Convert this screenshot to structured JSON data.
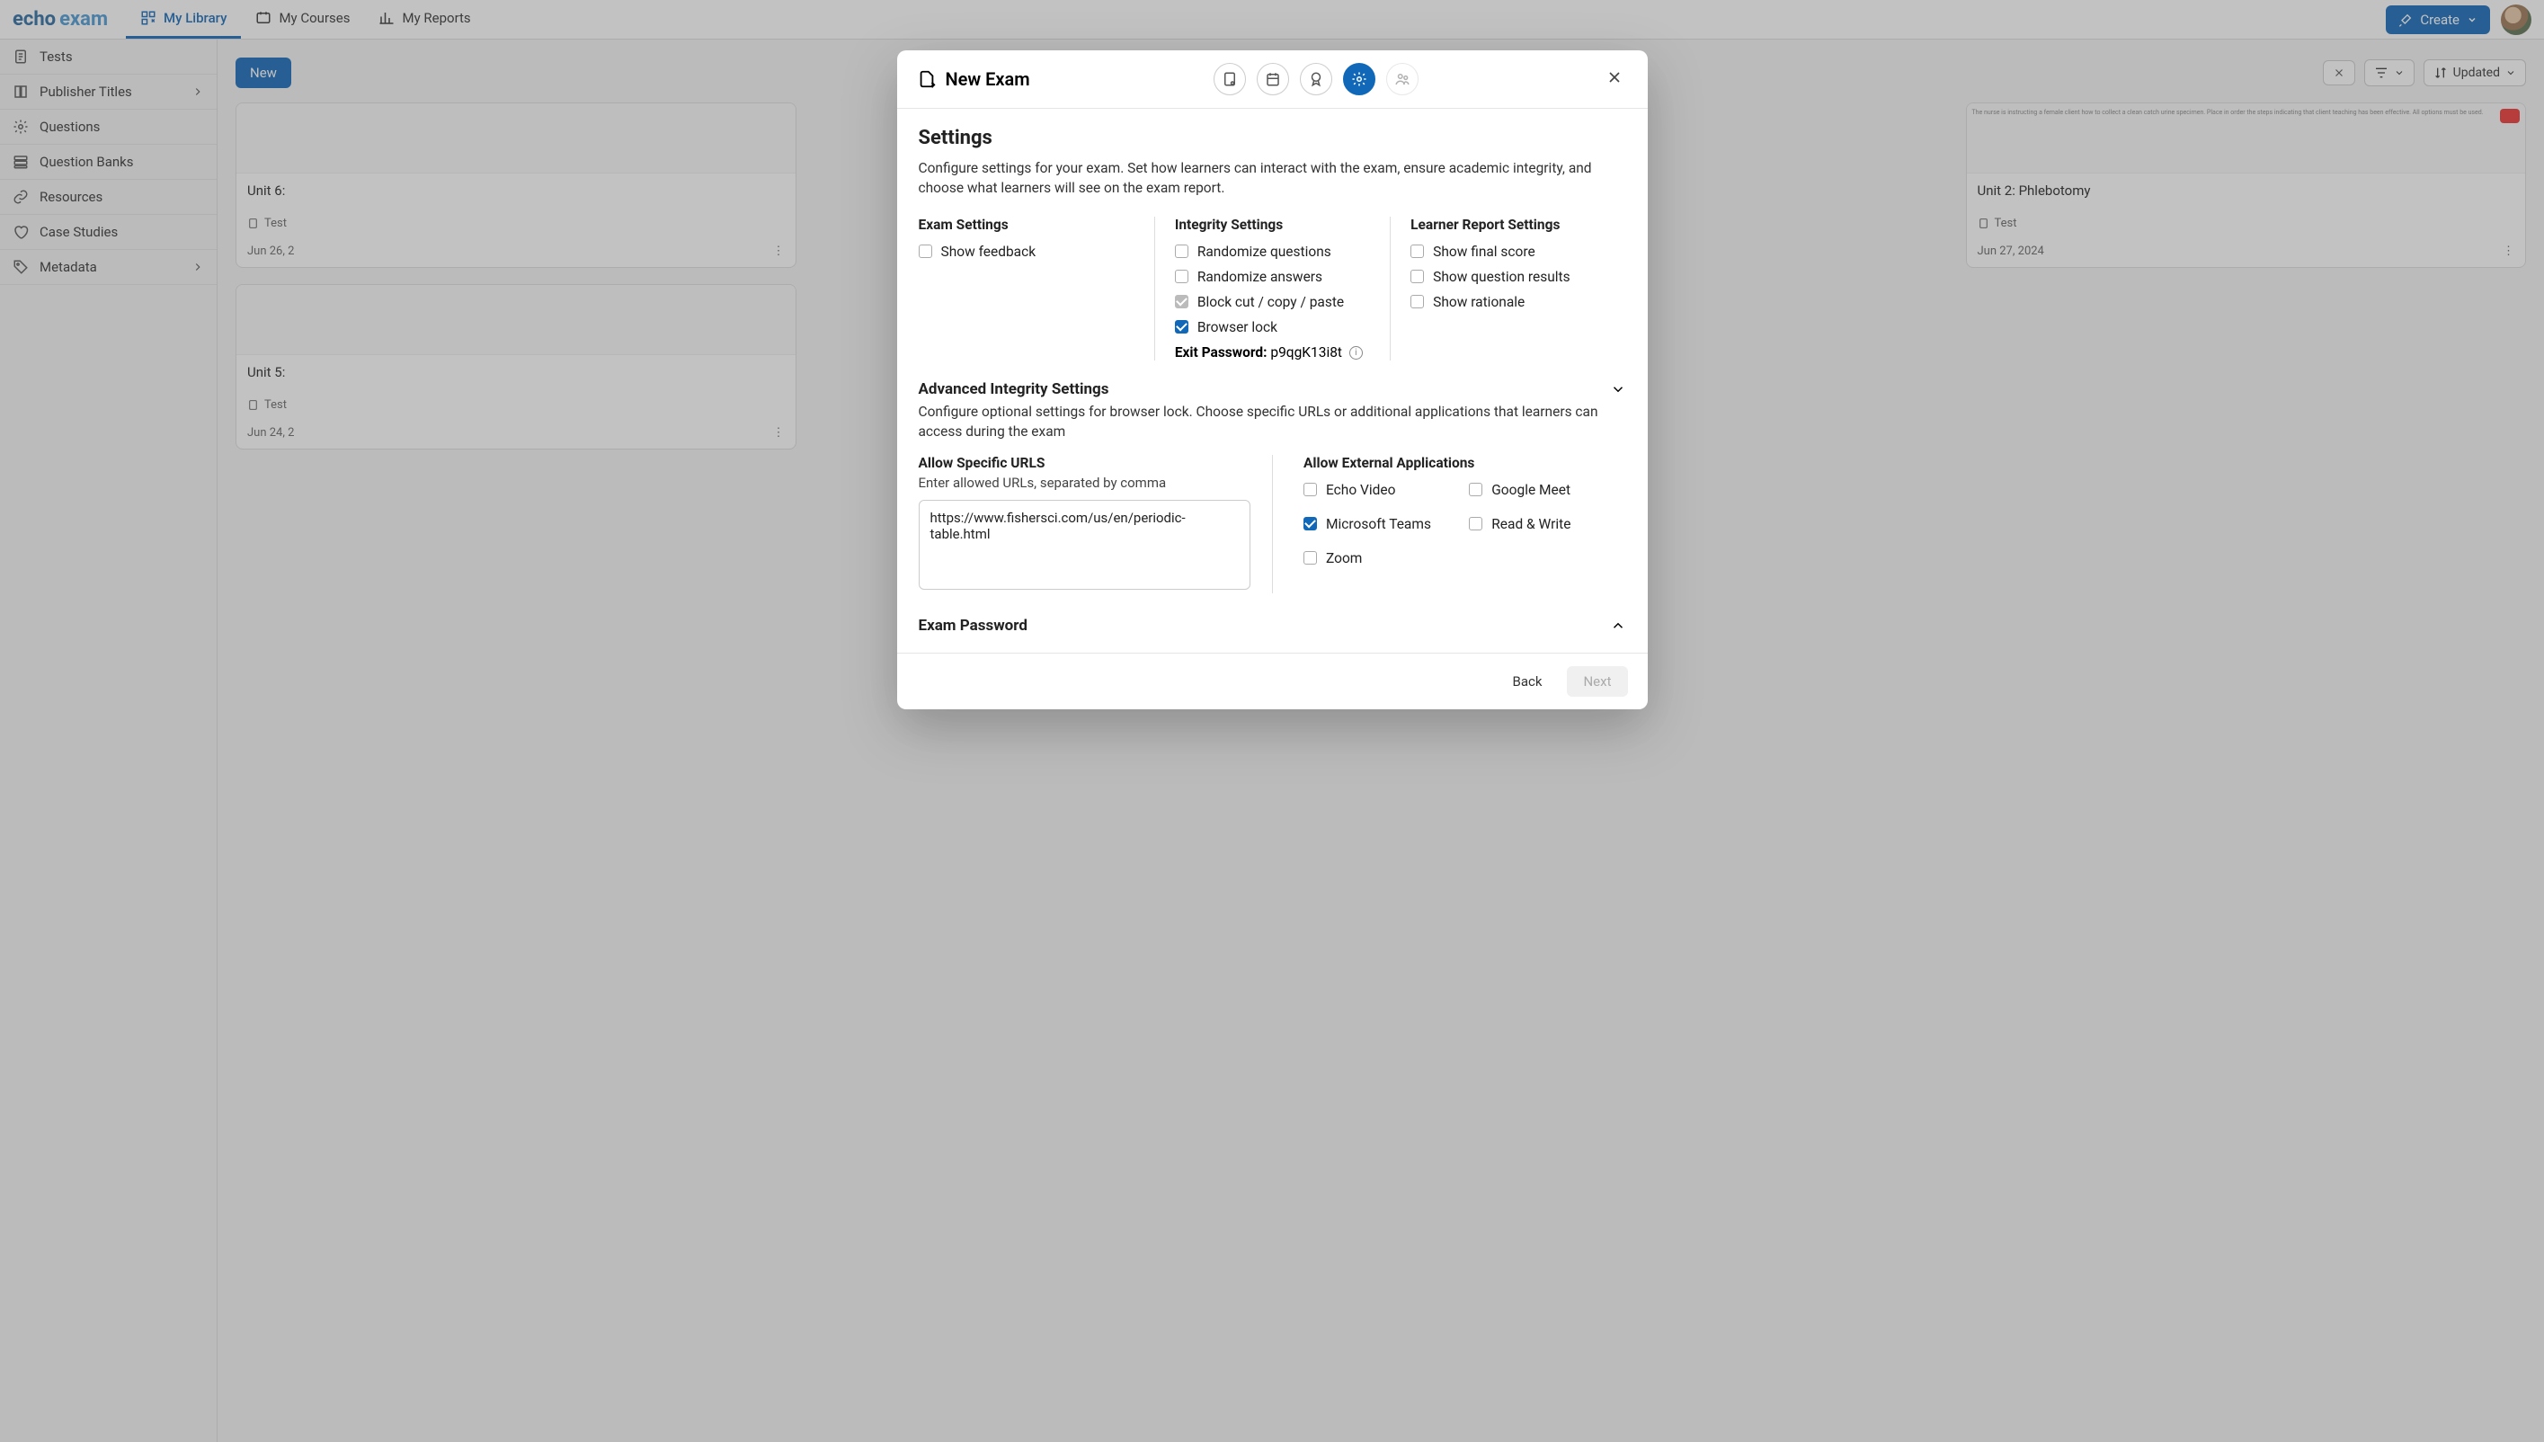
{
  "brand": {
    "part1": "echo",
    "part2": "exam"
  },
  "nav": {
    "library": "My Library",
    "courses": "My Courses",
    "reports": "My Reports",
    "create": "Create"
  },
  "sidebar": {
    "tests": "Tests",
    "publisher": "Publisher Titles",
    "questions": "Questions",
    "qbanks": "Question Banks",
    "resources": "Resources",
    "casestudies": "Case Studies",
    "metadata": "Metadata"
  },
  "toolbar": {
    "new": "New",
    "updated": "Updated"
  },
  "cards": [
    {
      "title": "Unit 6:",
      "type": "Test",
      "date": "Jun 26, 2"
    },
    {
      "title": "Unit 2: Phlebotomy",
      "type": "Test",
      "date": "Jun 27, 2024",
      "thumbText": "The nurse is instructing a female client how to collect a clean catch urine specimen. Place in order the steps indicating that client teaching has been effective. All options must be used."
    },
    {
      "title": "Unit 5:",
      "type": "Test",
      "date": "Jun 24, 2"
    }
  ],
  "modal": {
    "title": "New Exam",
    "settings_h": "Settings",
    "settings_p": "Configure settings for your exam. Set how learners can interact with the exam, ensure academic integrity, and choose what learners will see on the exam report.",
    "col1_h": "Exam Settings",
    "show_feedback": "Show feedback",
    "col2_h": "Integrity Settings",
    "rand_q": "Randomize questions",
    "rand_a": "Randomize answers",
    "block_ccp": "Block cut / copy / paste",
    "browser_lock": "Browser lock",
    "exit_pw_label": "Exit Password:",
    "exit_pw_value": "p9qgK13i8t",
    "col3_h": "Learner Report Settings",
    "show_score": "Show final score",
    "show_results": "Show question results",
    "show_rationale": "Show rationale",
    "adv_h": "Advanced Integrity Settings",
    "adv_p": "Configure optional settings for browser lock. Choose specific URLs or additional applications that learners can access during the exam",
    "urls_h": "Allow Specific URLS",
    "urls_hint": "Enter allowed URLs, separated by comma",
    "urls_value": "https://www.fishersci.com/us/en/periodic-table.html",
    "apps_h": "Allow External Applications",
    "apps": {
      "echo": "Echo Video",
      "gmeet": "Google Meet",
      "msteams": "Microsoft Teams",
      "rw": "Read & Write",
      "zoom": "Zoom"
    },
    "exam_pw_h": "Exam Password",
    "back": "Back",
    "next": "Next"
  }
}
